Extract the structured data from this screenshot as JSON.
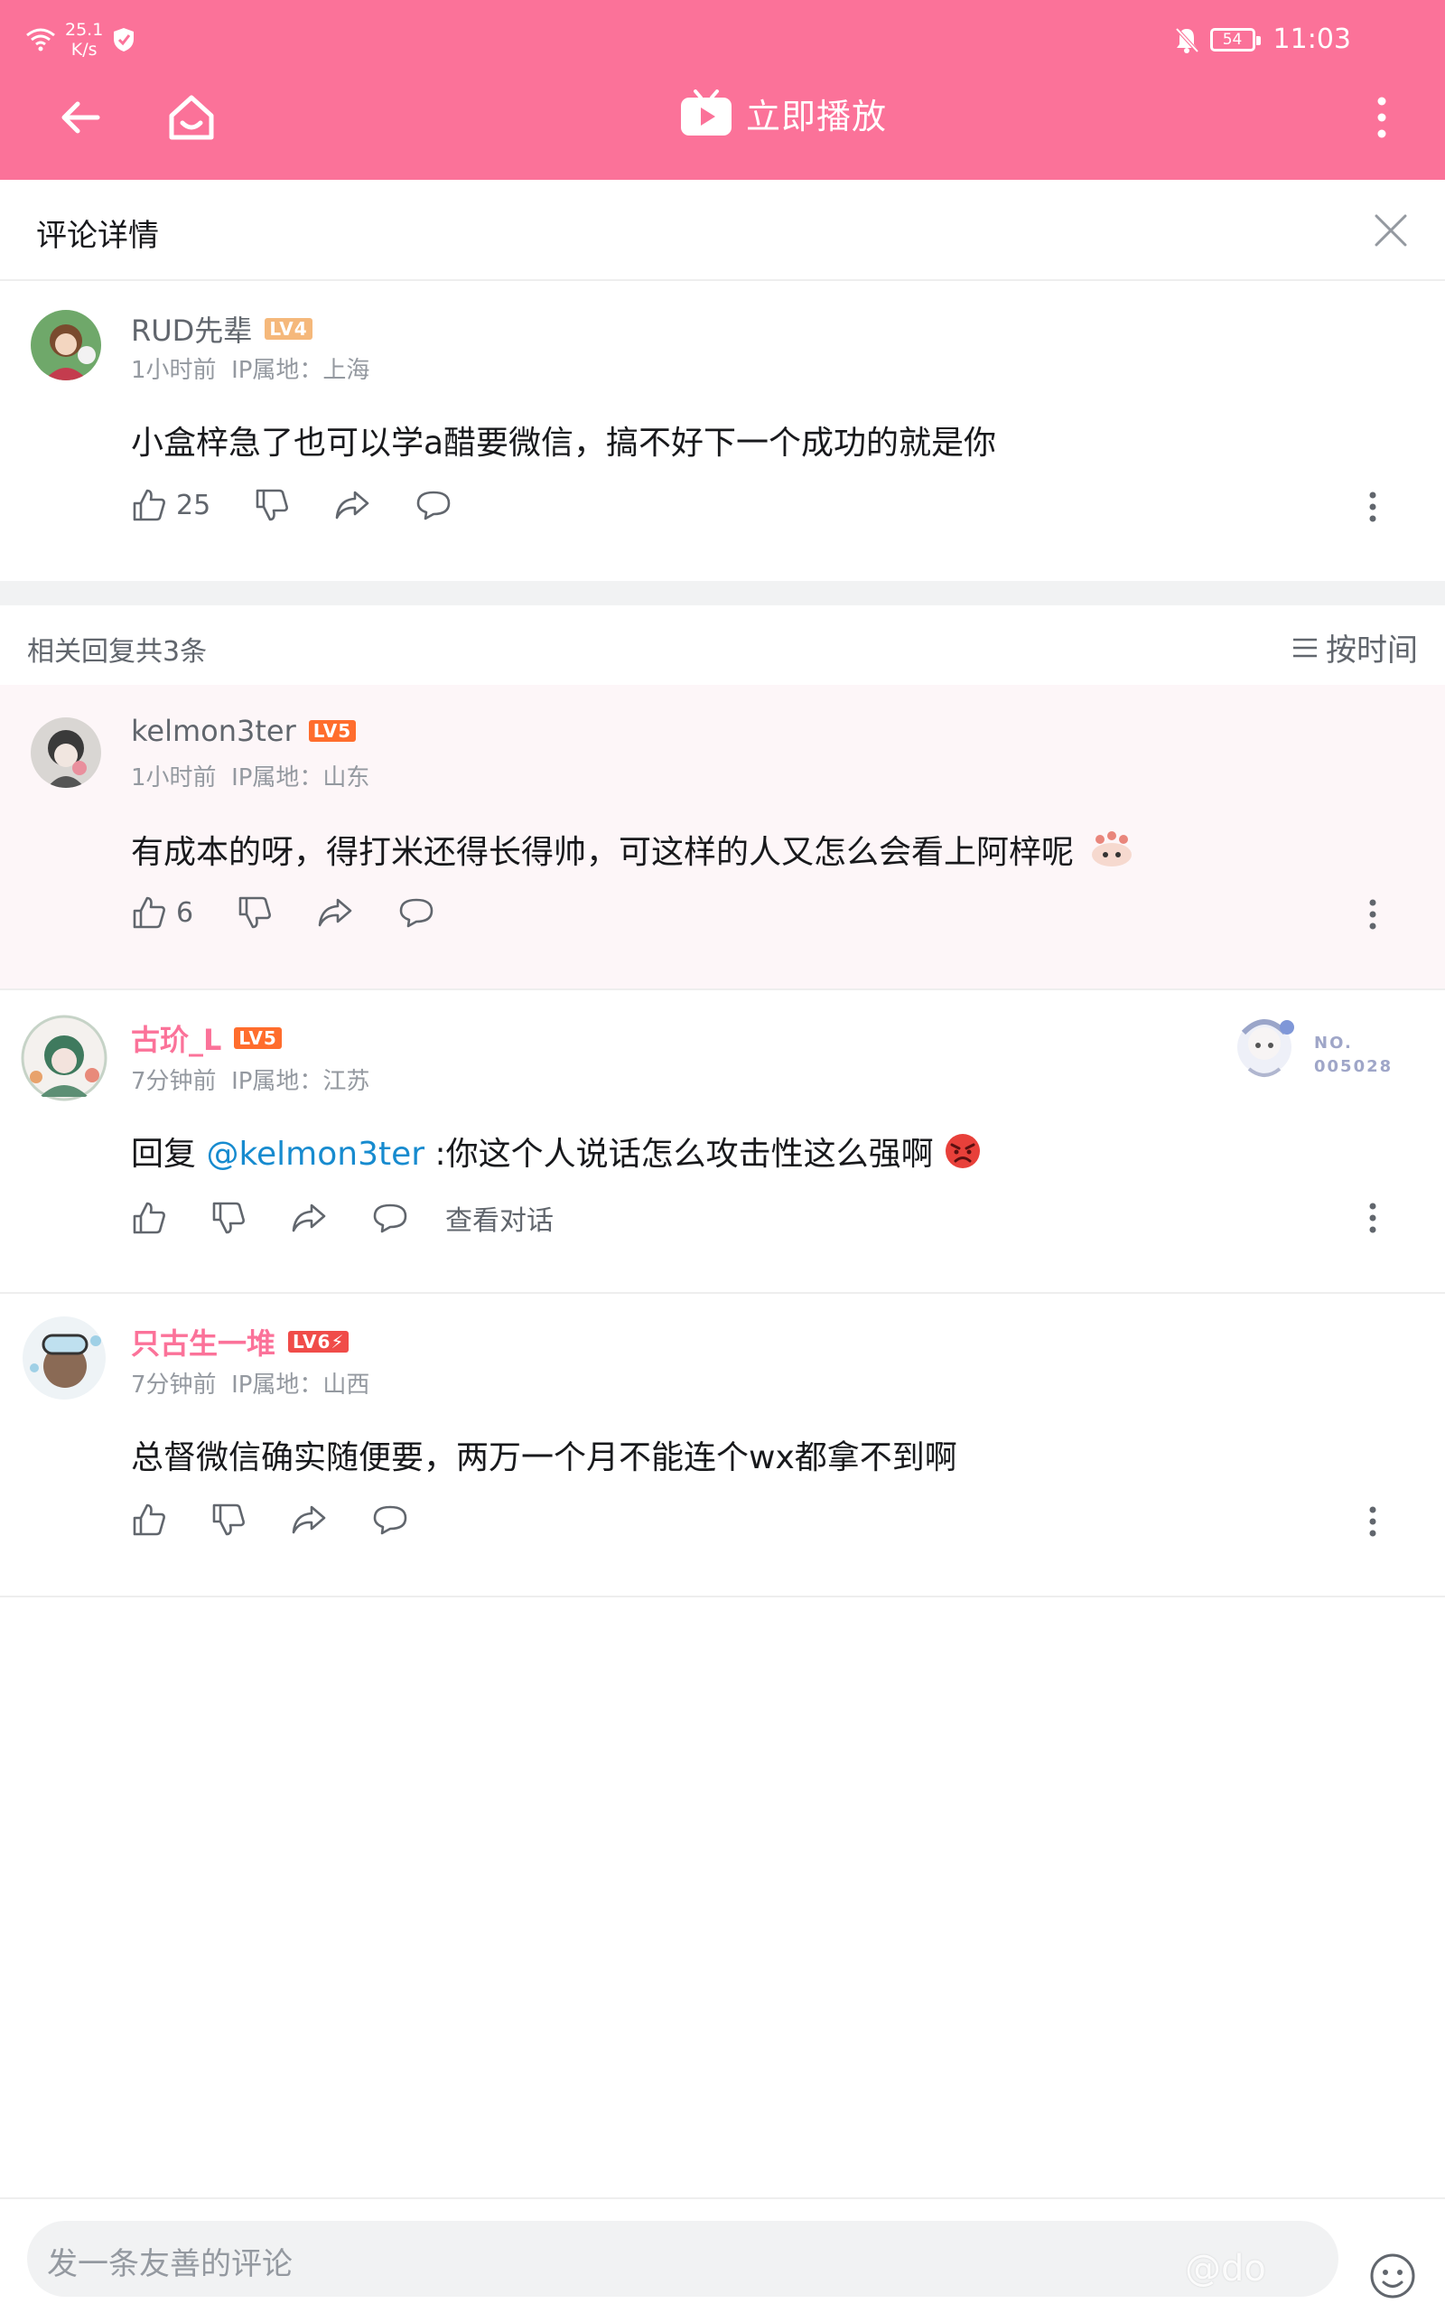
{
  "status_bar": {
    "net_speed_value": "25.1",
    "net_speed_unit": "K/s",
    "battery": "54",
    "time": "11:03"
  },
  "nav": {
    "play_label": "立即播放"
  },
  "header": {
    "title": "评论详情"
  },
  "main_comment": {
    "username": "RUD先辈",
    "level": "LV4",
    "level_color": "#f5b87b",
    "time": "1小时前",
    "ip": "IP属地：上海",
    "text": "小盒梓急了也可以学a醋要微信，搞不好下一个成功的就是你",
    "likes": "25"
  },
  "replies_header": {
    "count_label": "相关回复共3条",
    "sort_label": "按时间"
  },
  "replies": [
    {
      "username": "kelmon3ter",
      "level": "LV5",
      "level_color": "#ff6d2d",
      "time": "1小时前",
      "ip": "IP属地：山东",
      "text": "有成本的呀，得打米还得长得帅，可这样的人又怎么会看上阿梓呢",
      "likes": "6"
    },
    {
      "username": "古玠_L",
      "level": "LV5",
      "level_color": "#ff6d2d",
      "time": "7分钟前",
      "ip": "IP属地：江苏",
      "reply_prefix": "回复 ",
      "mention": "@kelmon3ter",
      "text": " :你这个人说话怎么攻击性这么强啊",
      "view_conversation": "查看对话",
      "fan_badge_no": "NO.",
      "fan_badge_num": "005028"
    },
    {
      "username": "只古生一堆",
      "level": "LV6⚡",
      "level_color": "#f04c49",
      "time": "7分钟前",
      "ip": "IP属地：山西",
      "text": "总督微信确实随便要，两万一个月不能连个wx都拿不到啊"
    }
  ],
  "bottom": {
    "input_placeholder": "发一条友善的评论",
    "watermark": "@do"
  },
  "colors": {
    "brand_pink": "#fb7299",
    "mention_blue": "#178bcf",
    "highlight_bg": "#fdf6f8"
  }
}
